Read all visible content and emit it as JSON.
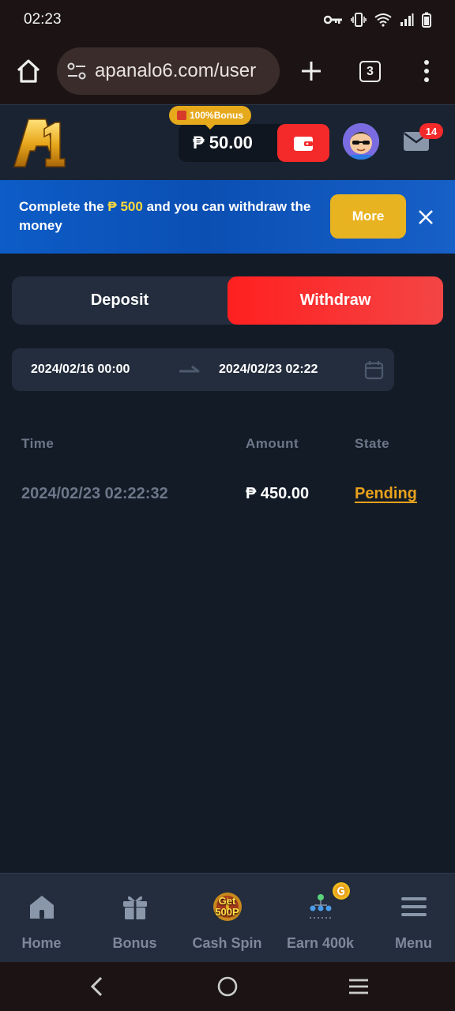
{
  "status_bar": {
    "time": "02:23"
  },
  "browser": {
    "url": "apanalo6.com/user",
    "tab_count": "3"
  },
  "header": {
    "bonus_tag": "100%Bonus",
    "balance": "₱ 50.00",
    "mail_badge": "14"
  },
  "promo": {
    "text_before": "Complete the ",
    "highlight": "₱ 500",
    "text_after": " and you can withdraw the money",
    "more_label": "More"
  },
  "tabs": [
    {
      "label": "Deposit",
      "active": false
    },
    {
      "label": "Withdraw",
      "active": true
    }
  ],
  "date_range": {
    "start": "2024/02/16 00:00",
    "end": "2024/02/23 02:22"
  },
  "table": {
    "headers": [
      "Time",
      "Amount",
      "State"
    ],
    "rows": [
      {
        "time": "2024/02/23 02:22:32",
        "amount": "₱ 450.00",
        "state": "Pending"
      }
    ]
  },
  "bottom_nav": [
    {
      "label": "Home",
      "icon": "home-icon"
    },
    {
      "label": "Bonus",
      "icon": "gift-icon"
    },
    {
      "label": "Cash Spin",
      "icon": "cash-spin-icon",
      "badge": "Get 500P"
    },
    {
      "label": "Earn 400k",
      "icon": "referral-icon"
    },
    {
      "label": "Menu",
      "icon": "menu-icon"
    }
  ],
  "colors": {
    "background": "#131b27",
    "accent_red": "#f42a2a",
    "accent_gold": "#e8b320",
    "promo_blue": "#0b4fb3",
    "pending": "#e8a21c"
  }
}
